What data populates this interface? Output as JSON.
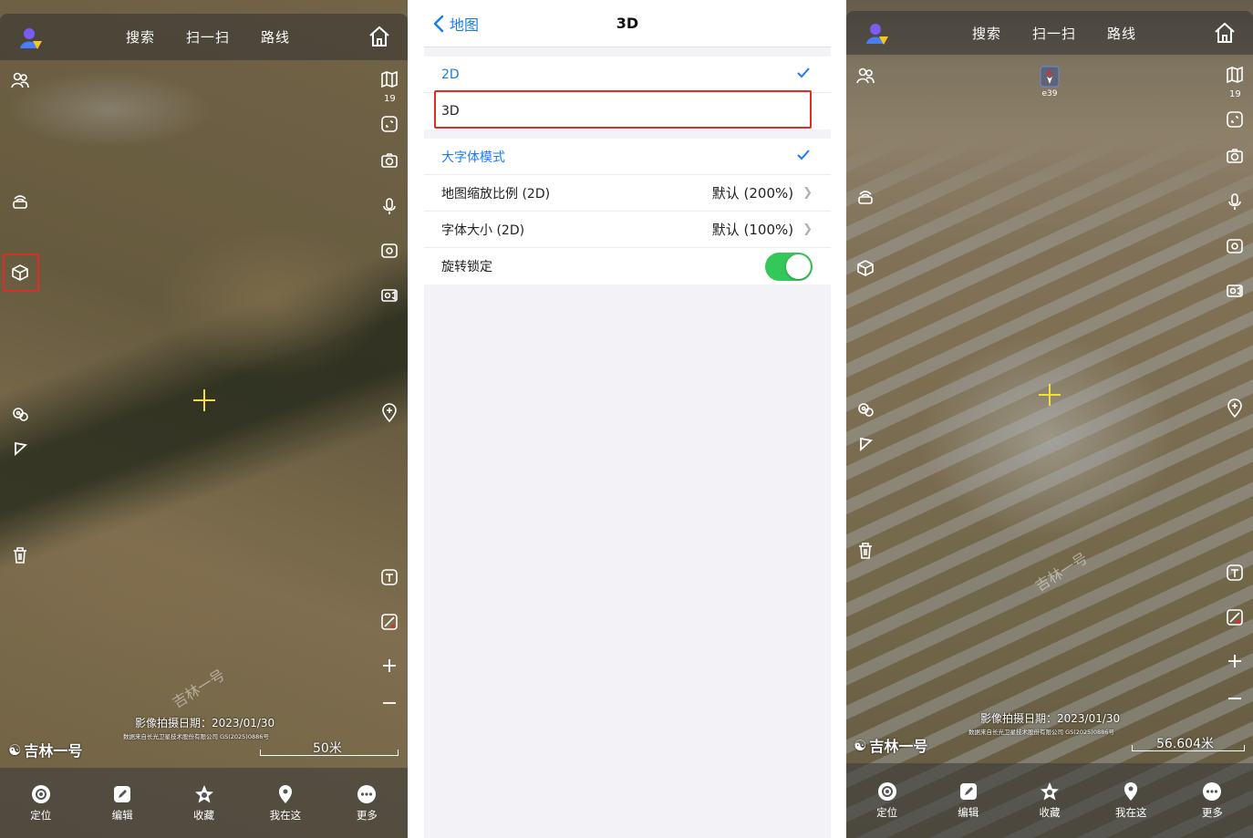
{
  "colors": {
    "accent_blue": "#1a7cf5",
    "highlight_red": "#e02b2b",
    "toggle_green": "#34c759",
    "crosshair_yellow": "#f0e03a"
  },
  "left_map": {
    "top_links": [
      "搜索",
      "扫一扫",
      "路线"
    ],
    "zoom_level": "19",
    "watermark": "吉林一号",
    "capture_date": "影像拍摄日期：2023/01/30",
    "source_note": "数据来自长光卫星技术股份有限公司 GS(2025)0886号",
    "brand": "吉林一号",
    "scale": "50米",
    "tabs": [
      {
        "label": "定位",
        "icon": "locate-icon"
      },
      {
        "label": "编辑",
        "icon": "edit-icon"
      },
      {
        "label": "收藏",
        "icon": "star-icon"
      },
      {
        "label": "我在这",
        "icon": "pin-icon"
      },
      {
        "label": "更多",
        "icon": "more-icon"
      }
    ]
  },
  "settings": {
    "back_label": "地图",
    "title": "3D",
    "view_modes": [
      {
        "label": "2D",
        "selected": true
      },
      {
        "label": "3D",
        "selected": false
      }
    ],
    "large_font": {
      "label": "大字体模式",
      "checked": true
    },
    "map_scale": {
      "label": "地图缩放比例 (2D)",
      "value": "默认 (200%)"
    },
    "font_size": {
      "label": "字体大小 (2D)",
      "value": "默认 (100%)"
    },
    "rotation_lock": {
      "label": "旋转锁定",
      "on": true
    }
  },
  "right_map": {
    "top_links": [
      "搜索",
      "扫一扫",
      "路线"
    ],
    "zoom_level": "19",
    "compass_label": "e39",
    "watermark": "吉林一号",
    "capture_date": "影像拍摄日期：2023/01/30",
    "source_note": "数据来自长光卫星技术股份有限公司 GS(2025)0886号",
    "brand": "吉林一号",
    "scale": "56.604米",
    "tabs": [
      {
        "label": "定位",
        "icon": "locate-icon"
      },
      {
        "label": "编辑",
        "icon": "edit-icon"
      },
      {
        "label": "收藏",
        "icon": "star-icon"
      },
      {
        "label": "我在这",
        "icon": "pin-icon"
      },
      {
        "label": "更多",
        "icon": "more-icon"
      }
    ]
  }
}
